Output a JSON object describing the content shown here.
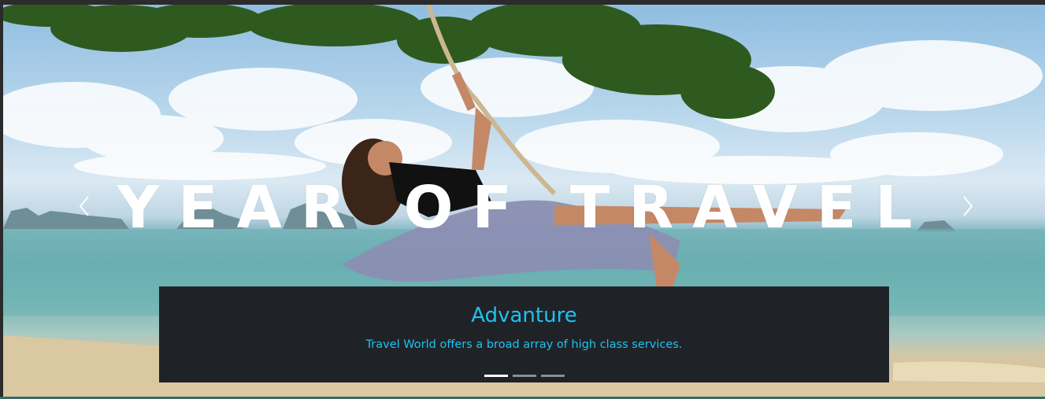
{
  "hero": {
    "headline": "YEAR OF TRAVEL",
    "image_description_icon": "beach-swing-photo"
  },
  "controls": {
    "prev_icon": "chevron-left-icon",
    "next_icon": "chevron-right-icon"
  },
  "caption": {
    "title": "Advanture",
    "text": "Travel World offers a broad array of high class services."
  },
  "indicators": [
    {
      "active": true
    },
    {
      "active": false
    },
    {
      "active": false
    }
  ],
  "colors": {
    "accent": "#1ec2ef",
    "caption_bg": "#1f2328"
  }
}
